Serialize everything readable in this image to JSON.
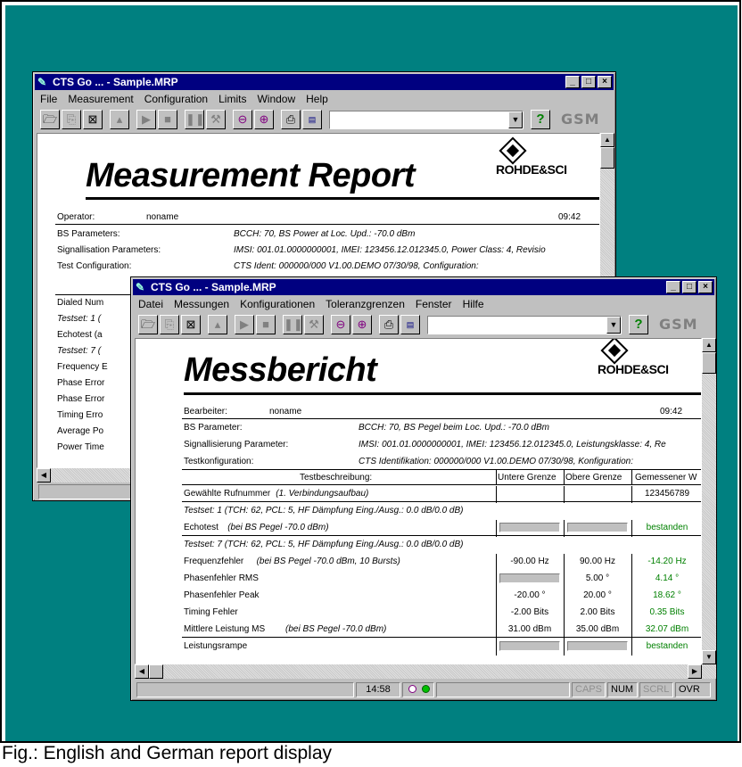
{
  "caption": "Fig.: English and German report display",
  "english": {
    "title": "CTS Go ... - Sample.MRP",
    "menu": [
      "File",
      "Measurement",
      "Configuration",
      "Limits",
      "Window",
      "Help"
    ],
    "logo_text": "GSM",
    "report_title": "Measurement Report",
    "company": "ROHDE&SCI",
    "operator_label": "Operator:",
    "operator_value": "noname",
    "time": "09:42",
    "fields": [
      {
        "label": "BS Parameters:",
        "value": "BCCH:  70, BS Power at Loc. Upd.: -70.0 dBm"
      },
      {
        "label": "Signallisation Parameters:",
        "value": "IMSI: 001.01.0000000001, IMEI: 123456.12.012345.0, Power Class: 4, Revisio"
      },
      {
        "label": "Test Configuration:",
        "value": "CTS Ident: 000000/000 V1.00.DEMO 07/30/98, Configuration:"
      }
    ],
    "rows": [
      "Dialed Num",
      "Testset: 1 (",
      "Echotest (a",
      "Testset: 7 (",
      "Frequency E",
      "Phase Error",
      "Phase Error",
      "Timing Erro",
      "Average Po",
      "Power Time"
    ]
  },
  "german": {
    "title": "CTS Go ... - Sample.MRP",
    "menu": [
      "Datei",
      "Messungen",
      "Konfigurationen",
      "Toleranzgrenzen",
      "Fenster",
      "Hilfe"
    ],
    "logo_text": "GSM",
    "report_title": "Messbericht",
    "company": "ROHDE&SCI",
    "operator_label": "Bearbeiter:",
    "operator_value": "noname",
    "time": "09:42",
    "fields": [
      {
        "label": "BS Parameter:",
        "value": "BCCH:  70, BS Pegel beim Loc. Upd.: -70.0 dBm"
      },
      {
        "label": "Signallisierung Parameter:",
        "value": "IMSI: 001.01.0000000001, IMEI: 123456.12.012345.0, Leistungsklasse: 4, Re"
      },
      {
        "label": "Testkonfiguration:",
        "value": "CTS Identifikation: 000000/000 V1.00.DEMO 07/30/98, Konfiguration:"
      }
    ],
    "columns": [
      "Testbeschreibung:",
      "Untere Grenze",
      "Obere Grenze",
      "Gemessener W"
    ],
    "rows": [
      {
        "desc": "Gewählte Rufnummer",
        "note": "(1. Verbindungsaufbau)",
        "lower": "",
        "upper": "",
        "measured": "123456789",
        "green": false
      },
      {
        "desc": "Testset:  1 (TCH:  62, PCL:  5, HF Dämpfung Eing./Ausg.: 0.0 dB/0.0 dB)",
        "note": "",
        "lower": "",
        "upper": "",
        "measured": "",
        "green": false,
        "italic": true
      },
      {
        "desc": "Echotest",
        "note": "(bei BS Pegel -70.0 dBm)",
        "lower": "box",
        "upper": "box",
        "measured": "bestanden",
        "green": true
      },
      {
        "desc": "Testset:  7 (TCH:  62, PCL:  5, HF Dämpfung Eing./Ausg.: 0.0 dB/0.0 dB)",
        "note": "",
        "lower": "",
        "upper": "",
        "measured": "",
        "green": false,
        "italic": true
      },
      {
        "desc": "Frequenzfehler",
        "note": "(bei BS Pegel -70.0 dBm, 10 Bursts)",
        "lower": "-90.00 Hz",
        "upper": "90.00 Hz",
        "measured": "-14.20 Hz",
        "green": true
      },
      {
        "desc": "Phasenfehler RMS",
        "note": "",
        "lower": "box",
        "upper": "5.00 °",
        "measured": "4.14 °",
        "green": true
      },
      {
        "desc": "Phasenfehler Peak",
        "note": "",
        "lower": "-20.00 °",
        "upper": "20.00 °",
        "measured": "18.62 °",
        "green": true
      },
      {
        "desc": "Timing Fehler",
        "note": "",
        "lower": "-2.00 Bits",
        "upper": "2.00 Bits",
        "measured": "0.35 Bits",
        "green": true
      },
      {
        "desc": "Mittlere Leistung MS",
        "note": "(bei BS Pegel -70.0 dBm)",
        "lower": "31.00 dBm",
        "upper": "35.00 dBm",
        "measured": "32.07 dBm",
        "green": true
      },
      {
        "desc": "Leistungsrampe",
        "note": "",
        "lower": "box",
        "upper": "box",
        "measured": "bestanden",
        "green": true
      }
    ],
    "status": {
      "clock": "14:58",
      "caps": "CAPS",
      "num": "NUM",
      "scrl": "SCRL",
      "ovr": "OVR"
    }
  }
}
